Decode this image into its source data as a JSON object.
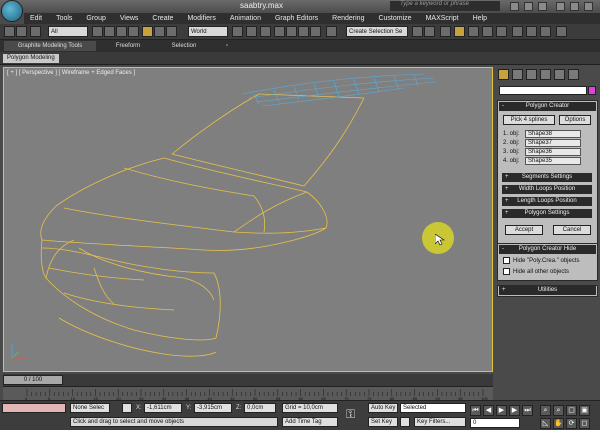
{
  "app": {
    "title": "saabtry.max",
    "search_placeholder": "Type a keyword or phrase"
  },
  "menu": [
    "Edit",
    "Tools",
    "Group",
    "Views",
    "Create",
    "Modifiers",
    "Animation",
    "Graph Editors",
    "Rendering",
    "Customize",
    "MAXScript",
    "Help"
  ],
  "toolbar": {
    "selection_filter": "All",
    "reference_coord": "World",
    "named_selection": "Create Selection Se"
  },
  "ribbon": {
    "tabs": [
      "Graphite Modeling Tools",
      "Freeform",
      "Selection"
    ],
    "subtab": "Polygon Modeling"
  },
  "viewport": {
    "label": "[ + ] [ Perspective ] [ Wireframe + Edged Faces ]"
  },
  "command_panel": {
    "polygon_creator": {
      "title": "Polygon Creator",
      "pick_button": "Pick 4 splines",
      "options_button": "Options",
      "objects": [
        {
          "label": "1. obj:",
          "value": "Shape38"
        },
        {
          "label": "2. obj:",
          "value": "Shape37"
        },
        {
          "label": "3. obj:",
          "value": "Shape36"
        },
        {
          "label": "4. obj:",
          "value": "Shape35"
        }
      ],
      "rollouts": [
        "Segments Settings",
        "Width Loops Position",
        "Length Loops Position",
        "Polygon Settings"
      ],
      "accept_button": "Accept",
      "cancel_button": "Cancel"
    },
    "polygon_creator_hide": {
      "title": "Polygon Creator Hide",
      "checkboxes": [
        "Hide \"Poly.Crea.\" objects",
        "Hide all other objects"
      ]
    },
    "utilities": {
      "title": "Utilities"
    }
  },
  "timeline": {
    "frame_display": "0 / 100",
    "ticks": [
      "0",
      "5",
      "10",
      "15",
      "20",
      "25",
      "30",
      "35",
      "40",
      "45",
      "50",
      "55",
      "60",
      "65",
      "70",
      "75",
      "80",
      "85",
      "90",
      "95",
      "100"
    ]
  },
  "status": {
    "selection": "None Selec",
    "x_label": "X:",
    "x_value": "-1,611cm",
    "y_label": "Y:",
    "y_value": "-3,915cm",
    "z_label": "Z:",
    "z_value": "0,0cm",
    "grid": "Grid = 10,0cm",
    "prompt": "Click and drag to select and move objects",
    "add_time_tag": "Add Time Tag",
    "auto_key": "Auto Key",
    "set_key": "Set Key",
    "key_mode": "Selected",
    "key_filters": "Key Filters...",
    "frame": "0"
  },
  "colors": {
    "wireframe": "#e8c24a",
    "accent": "#c8a23a",
    "cursor": "#d6d428"
  }
}
